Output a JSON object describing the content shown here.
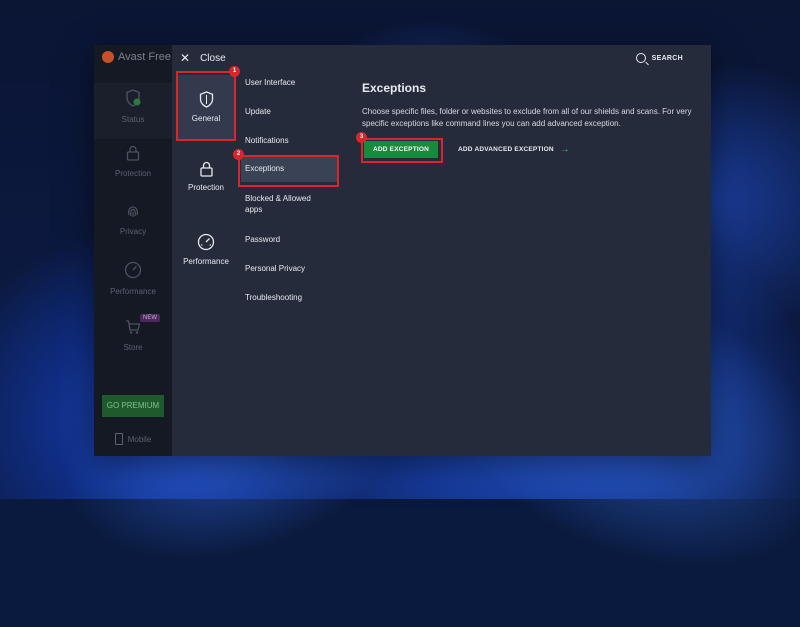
{
  "app": {
    "brand": "Avast Free",
    "nav": [
      {
        "label": "Status",
        "icon": "shield-check-icon"
      },
      {
        "label": "Protection",
        "icon": "lock-icon"
      },
      {
        "label": "Privacy",
        "icon": "fingerprint-icon"
      },
      {
        "label": "Performance",
        "icon": "speedometer-icon"
      },
      {
        "label": "Store",
        "icon": "cart-icon"
      }
    ],
    "store_badge": "NEW",
    "premium_label": "GO PREMIUM",
    "mobile_label": "Mobile"
  },
  "settings": {
    "close_label": "Close",
    "search_label": "SEARCH",
    "categories": [
      {
        "label": "General",
        "icon": "shield-icon"
      },
      {
        "label": "Protection",
        "icon": "lock-icon"
      },
      {
        "label": "Performance",
        "icon": "speedometer-icon"
      }
    ],
    "subitems": [
      "User Interface",
      "Update",
      "Notifications",
      "Exceptions",
      "Blocked & Allowed apps",
      "Password",
      "Personal Privacy",
      "Troubleshooting"
    ],
    "content": {
      "title": "Exceptions",
      "description": "Choose specific files, folder or websites to exclude from all of our shields and scans. For very specific exceptions like command lines you can add advanced exception.",
      "add_button": "ADD EXCEPTION",
      "advanced_button": "ADD ADVANCED EXCEPTION"
    },
    "steps": [
      "1",
      "2",
      "3"
    ]
  },
  "colors": {
    "highlight": "#d8262b",
    "accent_green": "#178a3c"
  }
}
